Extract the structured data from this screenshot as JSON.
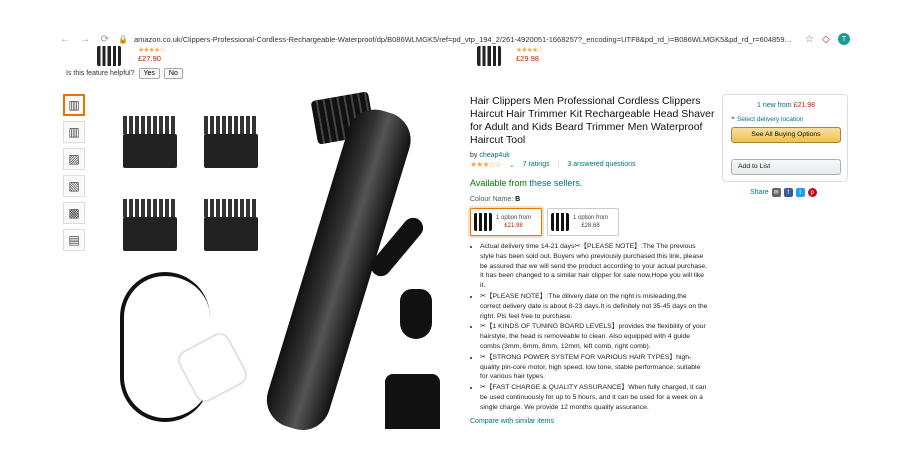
{
  "browser": {
    "url": "amazon.co.uk/Clippers-Professional-Cordless-Rechargeable-Waterproof/dp/B086WLMGK5/ref=pd_vtp_194_2/261-4920051-1668257?_encoding=UTF8&pd_rd_i=B086WLMGK5&pd_rd_r=60485933-...",
    "avatar_letter": "T"
  },
  "above": {
    "price1": "£27.90",
    "price2": "£29.98"
  },
  "helpful": {
    "question": "Is this feature helpful?",
    "yes_label": "Yes",
    "no_label": "No"
  },
  "product": {
    "title": "Hair Clippers Men Professional Cordless Clippers Haircut Hair Trimmer Kit Rechargeable Head Shaver for Adult and Kids Beard Trimmer Men Waterproof Haircut Tool",
    "by_prefix": "by",
    "brand": "cheap4uk",
    "stars": "★★★☆☆",
    "ratings_text": "7 ratings",
    "separator": "|",
    "questions_text": "3 answered questions",
    "availability_prefix": "Available from",
    "availability_link": "these sellers.",
    "colour_label": "Colour Name:",
    "colour_value": "B",
    "options": [
      {
        "line1": "1 option from",
        "price": "£21.98"
      },
      {
        "line1": "1 option from",
        "price": "£28.68"
      }
    ],
    "bullets": [
      "Actual delivery time 14-21 days✂【PLEASE NOTE】:The The previous style has been sold out. Buyers who previously purchased this link, please be assured that we will send the product according to your actual purchase. It has been changed to a similar hair clipper for sale now.Hope you will like it.",
      "✂【PLEASE NOTE】:The dilivery date on the right is misleading,the correct delivery date is about 8-23 days.It is definitely not 35-45 days on the right. Pls feel free to purchase.",
      "✂【1 KINDS OF TUNING BOARD LEVELS】provides the flexibility of your hairstyle, the head is removeable to clean. Also equipped with 4 guide combs (3mm, 6mm, 8mm, 12mm, left comb, right comb).",
      "✂【STRONG POWER SYSTEM FOR VARIOUS HAIR TYPES】high-quality pin-core motor, high speed, low tone, stable performance, suitable for various hair types.",
      "✂【FAST CHARGE & QUALITY ASSURANCE】When fully charged, it can be used continuously for up to 5 hours, and it can be used for a week on a single charge. We provide 12 months quality assurance."
    ],
    "compare_link": "Compare with similar items"
  },
  "buybox": {
    "new_from_prefix": "1 new from",
    "new_from_price": "£21.98",
    "delivery_location": "Select delivery location",
    "buying_options": "See All Buying Options",
    "add_to_list": "Add to List"
  },
  "share": {
    "label": "Share"
  },
  "colors": {
    "accent": "#e77600",
    "price": "#b12704",
    "link": "#007185",
    "success": "#007600"
  }
}
